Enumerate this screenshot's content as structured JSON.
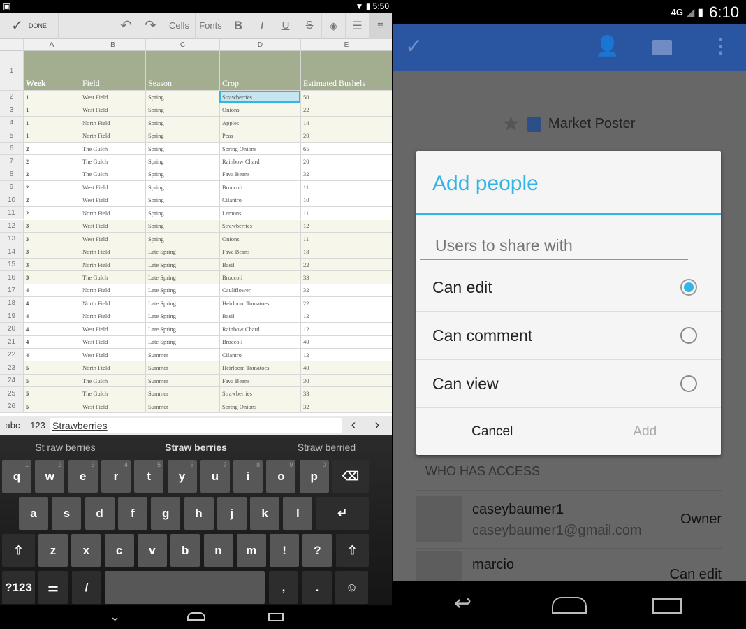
{
  "left": {
    "status_time": "5:50",
    "toolbar": {
      "done": "DONE",
      "cells": "Cells",
      "fonts": "Fonts",
      "bold": "B",
      "italic": "I",
      "underline": "U",
      "strike": "S"
    },
    "columns": [
      "A",
      "B",
      "C",
      "D",
      "E"
    ],
    "headers": [
      "Week",
      "Field",
      "Season",
      "Crop",
      "Estimated Bushels"
    ],
    "rows": [
      [
        "1",
        "West Field",
        "Spring",
        "Strawberries",
        "50"
      ],
      [
        "1",
        "West Field",
        "Spring",
        "Onions",
        "22"
      ],
      [
        "1",
        "North Field",
        "Spring",
        "Apples",
        "14"
      ],
      [
        "1",
        "North Field",
        "Spring",
        "Peas",
        "20"
      ],
      [
        "2",
        "The Gulch",
        "Spring",
        "Spring Onions",
        "65"
      ],
      [
        "2",
        "The Gulch",
        "Spring",
        "Rainbow Chard",
        "20"
      ],
      [
        "2",
        "The Gulch",
        "Spring",
        "Fava Beans",
        "32"
      ],
      [
        "2",
        "West Field",
        "Spring",
        "Broccoli",
        "11"
      ],
      [
        "2",
        "West Field",
        "Spring",
        "Cilantro",
        "10"
      ],
      [
        "2",
        "North Field",
        "Spring",
        "Lemons",
        "11"
      ],
      [
        "3",
        "West Field",
        "Spring",
        "Strawberries",
        "12"
      ],
      [
        "3",
        "West Field",
        "Spring",
        "Onions",
        "11"
      ],
      [
        "3",
        "North Field",
        "Late Spring",
        "Fava Beans",
        "18"
      ],
      [
        "3",
        "North Field",
        "Late Spring",
        "Basil",
        "22"
      ],
      [
        "3",
        "The Gulch",
        "Late Spring",
        "Broccoli",
        "33"
      ],
      [
        "4",
        "North Field",
        "Late Spring",
        "Cauliflower",
        "32"
      ],
      [
        "4",
        "North Field",
        "Late Spring",
        "Heirloom Tomatoes",
        "22"
      ],
      [
        "4",
        "North Field",
        "Late Spring",
        "Basil",
        "12"
      ],
      [
        "4",
        "West Field",
        "Late Spring",
        "Rainbow Chard",
        "12"
      ],
      [
        "4",
        "West Field",
        "Late Spring",
        "Broccoli",
        "40"
      ],
      [
        "4",
        "West Field",
        "Summer",
        "Cilantro",
        "12"
      ],
      [
        "5",
        "North Field",
        "Summer",
        "Heirloom Tomatoes",
        "40"
      ],
      [
        "5",
        "The Gulch",
        "Summer",
        "Fava Beans",
        "30"
      ],
      [
        "5",
        "The Gulch",
        "Summer",
        "Strawberries",
        "33"
      ],
      [
        "5",
        "West Field",
        "Summer",
        "Spring Onions",
        "32"
      ]
    ],
    "selected_cell": "D2",
    "formula_bar": {
      "abc": "abc",
      "num": "123",
      "value": "Strawberries"
    },
    "suggestions": [
      "St raw berries",
      "Straw berries",
      "Straw berried"
    ],
    "keys": {
      "row1": [
        [
          "q",
          "1"
        ],
        [
          "w",
          "2"
        ],
        [
          "e",
          "3"
        ],
        [
          "r",
          "4"
        ],
        [
          "t",
          "5"
        ],
        [
          "y",
          "6"
        ],
        [
          "u",
          "7"
        ],
        [
          "i",
          "8"
        ],
        [
          "o",
          "9"
        ],
        [
          "p",
          "0"
        ]
      ],
      "row2": [
        "a",
        "s",
        "d",
        "f",
        "g",
        "h",
        "j",
        "k",
        "l"
      ],
      "row3": [
        "z",
        "x",
        "c",
        "v",
        "b",
        "n",
        "m",
        "!",
        "?"
      ],
      "sym": "?123",
      "slash": "/",
      "comma": ",",
      "period": "."
    }
  },
  "right": {
    "status_time": "6:10",
    "network": "4G",
    "doc_title": "Market Poster",
    "dialog": {
      "title": "Add people",
      "placeholder": "Users to share with",
      "options": [
        {
          "label": "Can edit",
          "selected": true
        },
        {
          "label": "Can comment",
          "selected": false
        },
        {
          "label": "Can view",
          "selected": false
        }
      ],
      "cancel": "Cancel",
      "add": "Add"
    },
    "access_header": "WHO HAS ACCESS",
    "people": [
      {
        "name": "caseybaumer1",
        "email": "caseybaumer1@gmail.com",
        "role": "Owner"
      },
      {
        "name": "marcio",
        "email": "",
        "role": "Can edit"
      }
    ],
    "accent": "#33b5e5",
    "bar_color": "#2a55a0"
  }
}
